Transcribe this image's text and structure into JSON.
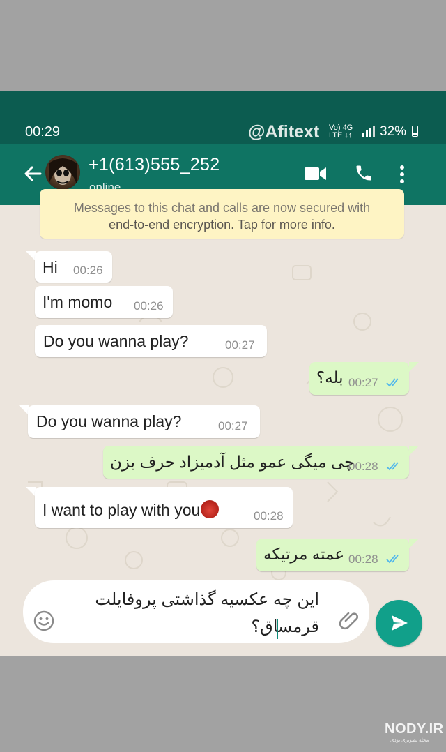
{
  "status_bar": {
    "time": "00:29",
    "watermark": "@Afitext",
    "network_top": "Vo) 4G",
    "network_bottom": "LTE ↓↑",
    "battery": "32%"
  },
  "header": {
    "contact_name": "+1(613)555_252",
    "contact_status": "online"
  },
  "encryption_notice": {
    "line1": "Messages to this chat and calls are now secured with",
    "line2": "end-to-end encryption. Tap for more info."
  },
  "messages": [
    {
      "direction": "in",
      "text": "Hi",
      "time": "00:26"
    },
    {
      "direction": "in",
      "text": "I'm momo",
      "time": "00:26"
    },
    {
      "direction": "in",
      "text": "Do you wanna play?",
      "time": "00:27"
    },
    {
      "direction": "out",
      "text": "بله؟",
      "time": "00:27",
      "status": "read"
    },
    {
      "direction": "in",
      "text": "Do you wanna play?",
      "time": "00:27"
    },
    {
      "direction": "out",
      "text": "چی میگی عمو مثل آدمیزاد حرف بزن",
      "time": "00:28",
      "status": "read"
    },
    {
      "direction": "in",
      "text": "I want to play with you",
      "emoji": "devil-face",
      "time": "00:28"
    },
    {
      "direction": "out",
      "text": "عمته مرتیکه",
      "time": "00:28",
      "status": "read"
    }
  ],
  "composer": {
    "line1": "این چه عکسیه گذاشتی پروفایلت",
    "line2": "قرمساق؟"
  },
  "site_watermark": {
    "name": "NODY.IR",
    "tagline": "مجله تصویری نودی"
  },
  "colors": {
    "status_bar": "#0c5c50",
    "app_bar": "#0f7463",
    "outgoing_bubble": "#dcf8c6",
    "incoming_bubble": "#ffffff",
    "send_button": "#11a08a",
    "read_ticks": "#4fb6ec"
  },
  "icons": [
    "back-arrow-icon",
    "video-call-icon",
    "phone-call-icon",
    "more-vert-icon",
    "emoji-icon",
    "attach-icon",
    "send-icon",
    "double-check-icon"
  ]
}
